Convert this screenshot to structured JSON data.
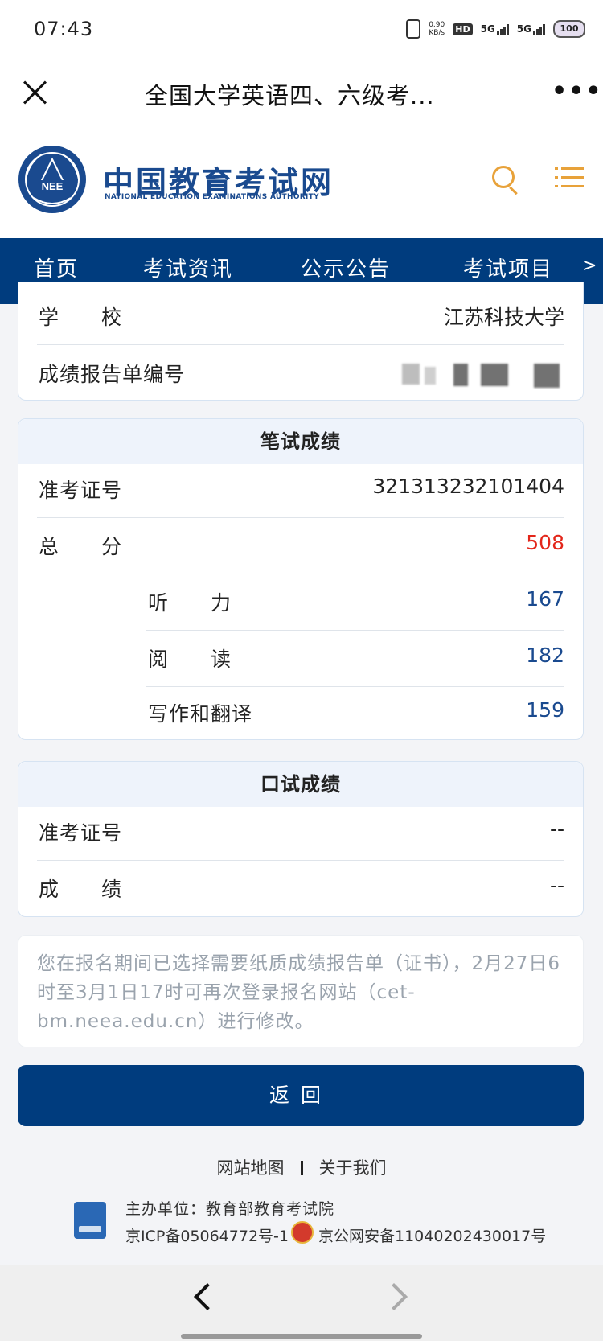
{
  "status_bar": {
    "time": "07:43",
    "net_speed": "0.90",
    "net_unit": "KB/s",
    "hd": "HD",
    "sim1": "5G",
    "sim2": "5G",
    "battery": "100"
  },
  "title_bar": {
    "title": "全国大学英语四、六级考...",
    "more": "•••"
  },
  "brand": {
    "name_cn": "中国教育考试网",
    "name_en": "NATIONAL EDUCATION EXAMINATIONS AUTHORITY",
    "logo_text": "NEE",
    "accent_color": "#e8a23a",
    "brand_color": "#003c7e"
  },
  "nav": {
    "items": [
      "首页",
      "考试资讯",
      "公示公告",
      "考试项目"
    ],
    "more": ">"
  },
  "info_card": {
    "school_label": "学　　校",
    "school_value": "江苏科技大学",
    "report_label": "成绩报告单编号"
  },
  "written": {
    "title": "笔试成绩",
    "ticket_label": "准考证号",
    "ticket_value": "321313232101404",
    "total_label": "总　　分",
    "total_value": "508",
    "listening_label": "听　　力",
    "listening_value": "167",
    "reading_label": "阅　　读",
    "reading_value": "182",
    "writing_label": "写作和翻译",
    "writing_value": "159"
  },
  "oral": {
    "title": "口试成绩",
    "ticket_label": "准考证号",
    "ticket_value": "--",
    "score_label": "成　　绩",
    "score_value": "--"
  },
  "notice": "您在报名期间已选择需要纸质成绩报告单（证书），2月27日6时至3月1日17时可再次登录报名网站（cet-bm.neea.edu.cn）进行修改。",
  "back_button": "返回",
  "footer": {
    "sitemap": "网站地图",
    "about": "关于我们",
    "sponsor": "主办单位：教育部教育考试院",
    "icp": "京ICP备05064772号-1",
    "police": "京公网安备11040202430017号"
  }
}
